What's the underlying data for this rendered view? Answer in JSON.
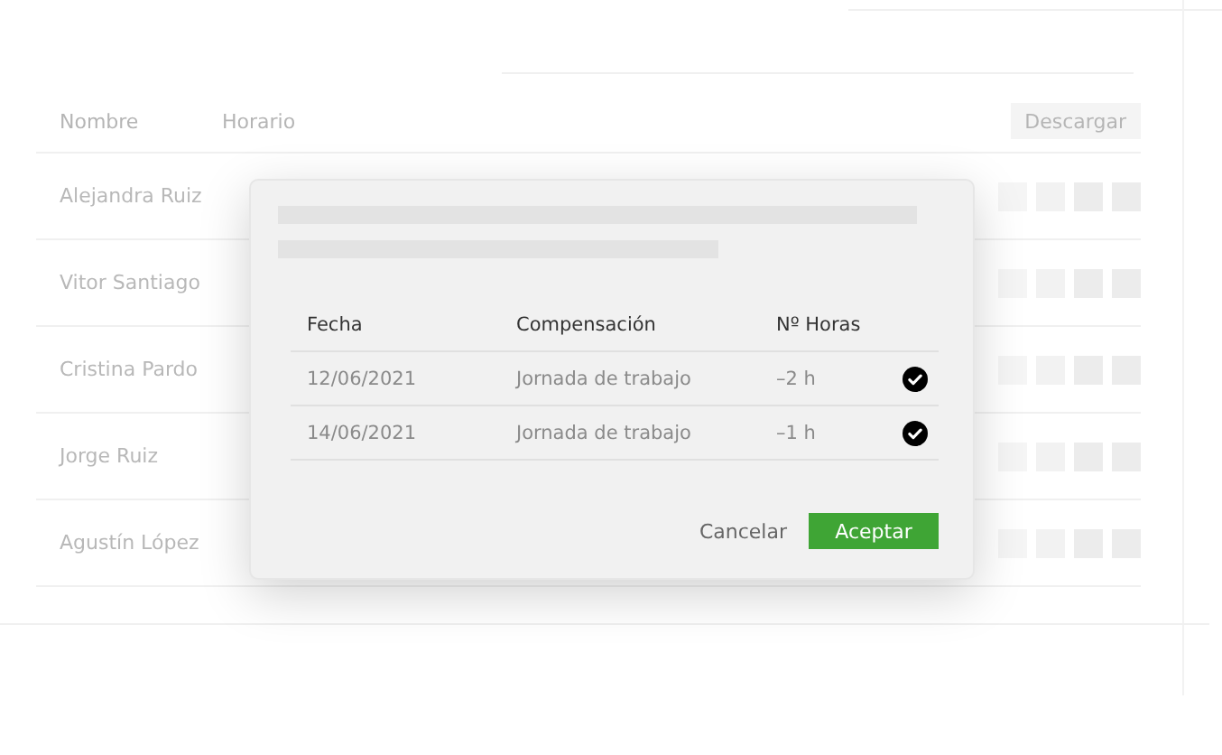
{
  "table": {
    "columns": [
      "Nombre",
      "Horario"
    ],
    "download_button": "Descargar",
    "rows": [
      {
        "name": "Alejandra Ruiz"
      },
      {
        "name": "Vitor Santiago"
      },
      {
        "name": "Cristina Pardo"
      },
      {
        "name": "Jorge Ruiz"
      },
      {
        "name": "Agustín López"
      }
    ]
  },
  "dialog": {
    "columns": [
      "Fecha",
      "Compensación",
      "Nº Horas"
    ],
    "rows": [
      {
        "date": "12/06/2021",
        "compensation": "Jornada de trabajo",
        "hours": "–2 h",
        "checked": true
      },
      {
        "date": "14/06/2021",
        "compensation": "Jornada de trabajo",
        "hours": "–1 h",
        "checked": true
      }
    ],
    "buttons": [
      {
        "label": "Cancelar",
        "kind": "text"
      },
      {
        "label": "Aceptar",
        "kind": "primary"
      }
    ]
  }
}
